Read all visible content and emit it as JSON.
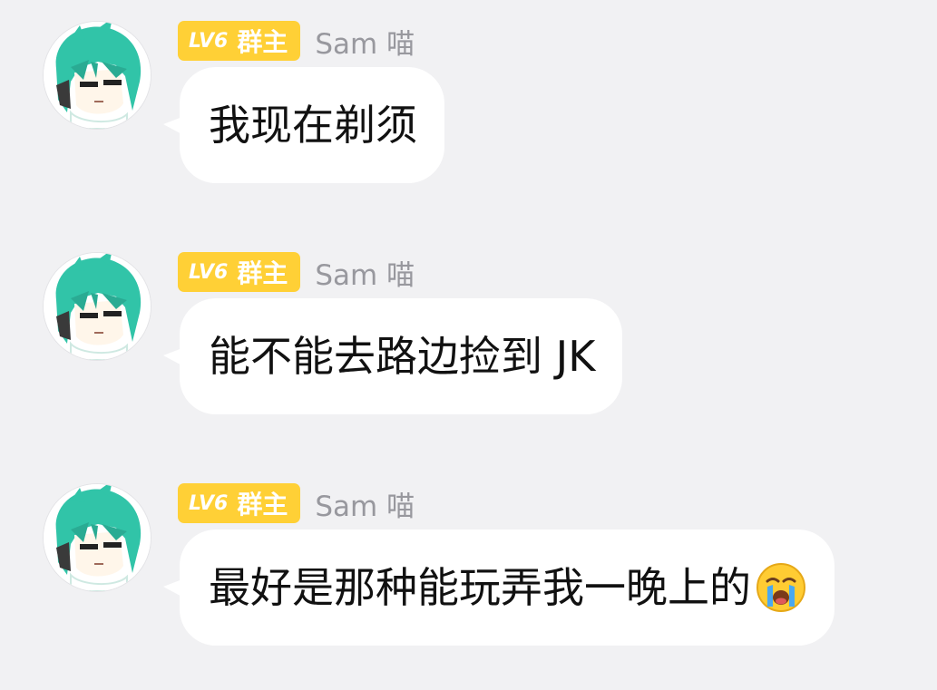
{
  "messages": [
    {
      "sender": "Sam 喵",
      "badge": {
        "level": "LV6",
        "role": "群主"
      },
      "text": "我现在剃须",
      "emoji": null
    },
    {
      "sender": "Sam 喵",
      "badge": {
        "level": "LV6",
        "role": "群主"
      },
      "text": "能不能去路边捡到 JK",
      "emoji": null
    },
    {
      "sender": "Sam 喵",
      "badge": {
        "level": "LV6",
        "role": "群主"
      },
      "text": "最好是那种能玩弄我一晚上的",
      "emoji": "loudly-crying-face-icon"
    }
  ],
  "colors": {
    "background": "#f1f1f3",
    "bubble": "#ffffff",
    "badge": "#ffd036",
    "sender_name": "#98989e",
    "avatar_hair": "#31c4a8"
  }
}
